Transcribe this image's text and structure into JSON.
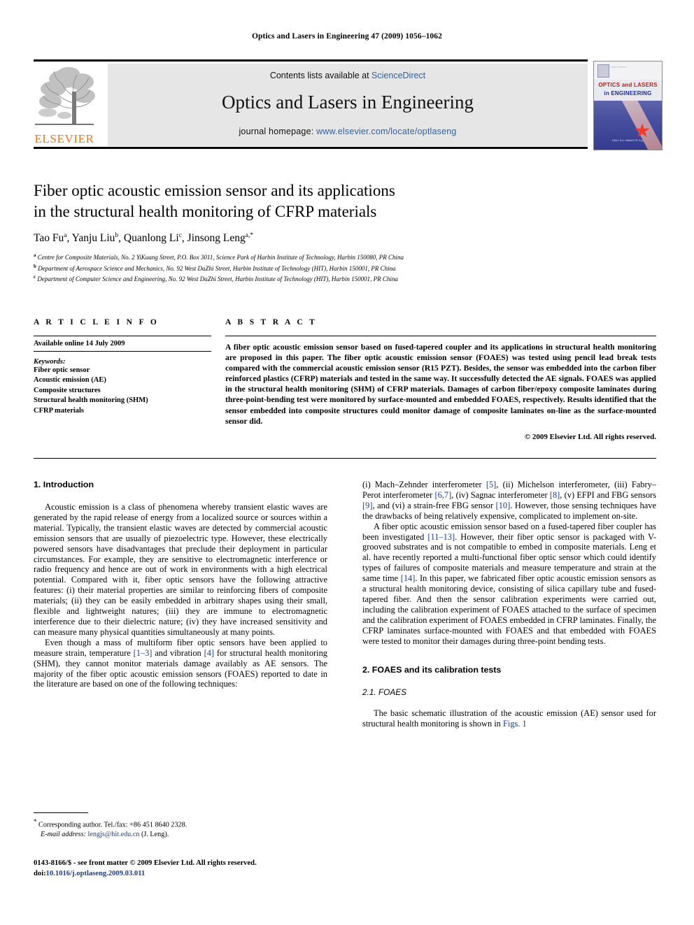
{
  "running_head": "Optics and Lasers in Engineering 47 (2009) 1056–1062",
  "masthead": {
    "contents_prefix": "Contents lists available at ",
    "sciencedirect": "ScienceDirect",
    "journal_title": "Optics and Lasers in Engineering",
    "homepage_prefix": "journal homepage: ",
    "homepage_url": "www.elsevier.com/locate/optlaseng",
    "publisher_wordmark": "ELSEVIER",
    "link_color": "#2B61A8",
    "panel_color": "#e6e6e6"
  },
  "cover": {
    "line1": "OPTICS and LASERS",
    "line2": "in ENGINEERING",
    "editor_note": "Editor:\nN.A. Halliwell FR. Eng."
  },
  "article": {
    "title_line1": "Fiber optic acoustic emission sensor and its applications",
    "title_line2": "in the structural health monitoring of CFRP materials",
    "authors_html": "Tao Fu a, Yanju Liu b, Quanlong Li c, Jinsong Leng a,*",
    "authors": [
      {
        "name": "Tao Fu",
        "sup": "a"
      },
      {
        "name": "Yanju Liu",
        "sup": "b"
      },
      {
        "name": "Quanlong Li",
        "sup": "c"
      },
      {
        "name": "Jinsong Leng",
        "sup": "a,*"
      }
    ],
    "affiliations": [
      {
        "marker": "a",
        "text": "Centre for Composite Materials, No. 2 YiKuang Street, P.O. Box 3011, Science Park of Harbin Institute of Technology, Harbin 150080, PR China"
      },
      {
        "marker": "b",
        "text": "Department of Aerospace Science and Mechanics, No. 92 West DaZhi Street, Harbin Institute of Technology (HIT), Harbin 150001, PR China"
      },
      {
        "marker": "c",
        "text": "Department of Computer Science and Engineering, No. 92 West DaZhi Street, Harbin Institute of Technology (HIT), Harbin 150001, PR China"
      }
    ]
  },
  "article_info": {
    "heading": "A R T I C L E   I N F O",
    "available_online": "Available online 14 July 2009",
    "keywords_label": "Keywords:",
    "keywords": [
      "Fiber optic sensor",
      "Acoustic emission (AE)",
      "Composite structures",
      "Structural health monitoring (SHM)",
      "CFRP materials"
    ]
  },
  "abstract": {
    "heading": "A B S T R A C T",
    "text": "A fiber optic acoustic emission sensor based on fused-tapered coupler and its applications in structural health monitoring are proposed in this paper. The fiber optic acoustic emission sensor (FOAES) was tested using pencil lead break tests compared with the commercial acoustic emission sensor (R15 PZT). Besides, the sensor was embedded into the carbon fiber reinforced plastics (CFRP) materials and tested in the same way. It successfully detected the AE signals. FOAES was applied in the structural health monitoring (SHM) of CFRP materials. Damages of carbon fiber/epoxy composite laminates during three-point-bending test were monitored by surface-mounted and embedded FOAES, respectively. Results identified that the sensor embedded into composite structures could monitor damage of composite laminates on-line as the surface-mounted sensor did.",
    "copyright": "© 2009 Elsevier Ltd. All rights reserved."
  },
  "body": {
    "section1_heading": "1.  Introduction",
    "left_p1": "Acoustic emission is a class of phenomena whereby transient elastic waves are generated by the rapid release of energy from a localized source or sources within a material. Typically, the transient elastic waves are detected by commercial acoustic emission sensors that are usually of piezoelectric type. However, these electrically powered sensors have disadvantages that preclude their deployment in particular circumstances. For example, they are sensitive to electromagnetic interference or radio frequency and hence are out of work in environments with a high electrical potential. Compared with it, fiber optic sensors have the following attractive features: (i) their material properties are similar to reinforcing fibers of composite materials; (ii) they can be easily embedded in arbitrary shapes using their small, flexible and lightweight natures; (iii) they are immune to electromagnetic interference due to their dielectric nature; (iv) they have increased sensitivity and can measure many physical quantities simultaneously at many points.",
    "left_p2_a": "Even though a mass of multiform fiber optic sensors have been applied to measure strain, temperature ",
    "left_p2_ref1": "[1–3]",
    "left_p2_b": " and vibration ",
    "left_p2_ref2": "[4]",
    "left_p2_c": " for structural health monitoring (SHM), they cannot monitor materials damage availably as AE sensors. The majority of the fiber optic acoustic emission sensors (FOAES) reported to date in the literature are based on one of the following techniques:",
    "right_p1_a": "(i) Mach–Zehnder interferometer ",
    "right_p1_ref1": "[5]",
    "right_p1_b": ", (ii) Michelson interferometer, (iii) Fabry–Perot interferometer ",
    "right_p1_ref2": "[6,7]",
    "right_p1_c": ", (iv) Sagnac interferometer ",
    "right_p1_ref3": "[8]",
    "right_p1_d": ", (v) EFPI and FBG sensors ",
    "right_p1_ref4": "[9]",
    "right_p1_e": ", and (vi) a strain-free FBG sensor ",
    "right_p1_ref5": "[10]",
    "right_p1_f": ". However, those sensing techniques have the drawbacks of being relatively expensive, complicated to implement on-site.",
    "right_p2_a": "A fiber optic acoustic emission sensor based on a fused-tapered fiber coupler has been investigated ",
    "right_p2_ref1": "[11–13]",
    "right_p2_b": ". However, their fiber optic sensor is packaged with V-grooved substrates and is not compatible to embed in composite materials. Leng et al. have recently reported a multi-functional fiber optic sensor which could identify types of failures of composite materials and measure temperature and strain at the same time ",
    "right_p2_ref2": "[14]",
    "right_p2_c": ". In this paper, we fabricated fiber optic acoustic emission sensors as a structural health monitoring device, consisting of silica capillary tube and fused-tapered fiber. And then the sensor calibration experiments were carried out, including the calibration experiment of FOAES attached to the surface of specimen and the calibration experiment of FOAES embedded in CFRP laminates. Finally, the CFRP laminates surface-mounted with FOAES and that embedded with FOAES were tested to monitor their damages during three-point bending tests.",
    "section2_heading": "2.  FOAES and its calibration tests",
    "subsection21_heading": "2.1.  FOAES",
    "right_p3_a": "The basic schematic illustration of the acoustic emission (AE) sensor used for structural health monitoring is shown in ",
    "right_p3_ref1": "Figs. 1"
  },
  "footnotes": {
    "corresponding_marker": "*",
    "corresponding": "Corresponding author. Tel./fax: +86 451 8640 2328.",
    "email_label": "E-mail address:",
    "email": "lengjs@hit.edu.cn",
    "email_owner": "(J. Leng).",
    "issn_line": "0143-8166/$ - see front matter © 2009 Elsevier Ltd. All rights reserved.",
    "doi_label": "doi:",
    "doi": "10.1016/j.optlaseng.2009.03.011"
  }
}
